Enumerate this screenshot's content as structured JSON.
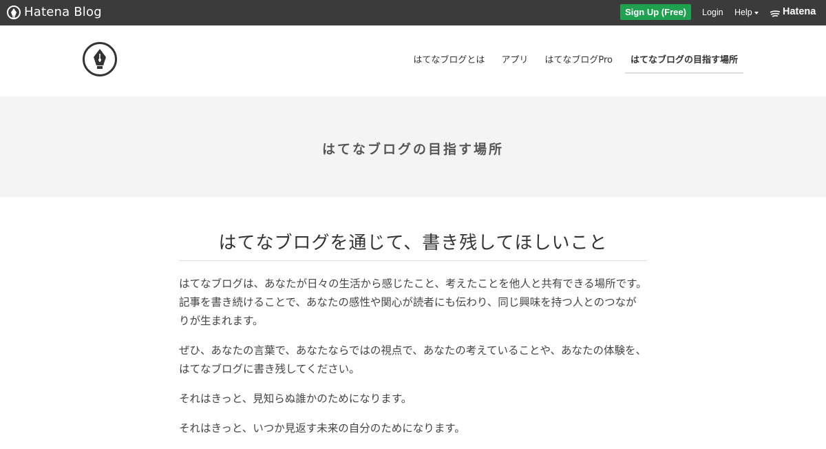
{
  "globalbar": {
    "brand": "Hatena Blog",
    "signup_label": "Sign Up (Free)",
    "login_label": "Login",
    "help_label": "Help",
    "hatena_label": "Hatena"
  },
  "nav": {
    "items": [
      {
        "label": "はてなブログとは"
      },
      {
        "label": "アプリ"
      },
      {
        "label": "はてなブログPro"
      },
      {
        "label": "はてなブログの目指す場所"
      }
    ]
  },
  "banner": {
    "title": "はてなブログの目指す場所"
  },
  "article": {
    "heading": "はてなブログを通じて、書き残してほしいこと",
    "paragraphs": [
      "はてなブログは、あなたが日々の生活から感じたこと、考えたことを他人と共有できる場所です。記事を書き続けることで、あなたの感性や関心が読者にも伝わり、同じ興味を持つ人とのつながりが生まれます。",
      "ぜひ、あなたの言葉で、あなたならではの視点で、あなたの考えていることや、あなたの体験を、はてなブログに書き残してください。",
      "それはきっと、見知らぬ誰かのためになります。",
      "それはきっと、いつか見返す未来の自分のためになります。"
    ]
  },
  "colors": {
    "globalbar_bg": "#3b3b3b",
    "signup_bg": "#1fa14f",
    "banner_bg": "#f4f4f4"
  }
}
